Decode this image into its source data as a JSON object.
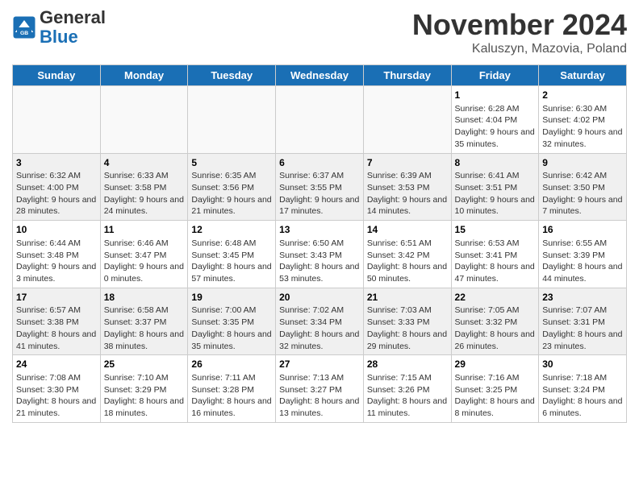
{
  "header": {
    "logo_line1": "General",
    "logo_line2": "Blue",
    "month_title": "November 2024",
    "location": "Kaluszyn, Mazovia, Poland"
  },
  "days_of_week": [
    "Sunday",
    "Monday",
    "Tuesday",
    "Wednesday",
    "Thursday",
    "Friday",
    "Saturday"
  ],
  "weeks": [
    [
      {
        "day": "",
        "info": "",
        "empty": true
      },
      {
        "day": "",
        "info": "",
        "empty": true
      },
      {
        "day": "",
        "info": "",
        "empty": true
      },
      {
        "day": "",
        "info": "",
        "empty": true
      },
      {
        "day": "",
        "info": "",
        "empty": true
      },
      {
        "day": "1",
        "info": "Sunrise: 6:28 AM\nSunset: 4:04 PM\nDaylight: 9 hours and 35 minutes."
      },
      {
        "day": "2",
        "info": "Sunrise: 6:30 AM\nSunset: 4:02 PM\nDaylight: 9 hours and 32 minutes."
      }
    ],
    [
      {
        "day": "3",
        "info": "Sunrise: 6:32 AM\nSunset: 4:00 PM\nDaylight: 9 hours and 28 minutes."
      },
      {
        "day": "4",
        "info": "Sunrise: 6:33 AM\nSunset: 3:58 PM\nDaylight: 9 hours and 24 minutes."
      },
      {
        "day": "5",
        "info": "Sunrise: 6:35 AM\nSunset: 3:56 PM\nDaylight: 9 hours and 21 minutes."
      },
      {
        "day": "6",
        "info": "Sunrise: 6:37 AM\nSunset: 3:55 PM\nDaylight: 9 hours and 17 minutes."
      },
      {
        "day": "7",
        "info": "Sunrise: 6:39 AM\nSunset: 3:53 PM\nDaylight: 9 hours and 14 minutes."
      },
      {
        "day": "8",
        "info": "Sunrise: 6:41 AM\nSunset: 3:51 PM\nDaylight: 9 hours and 10 minutes."
      },
      {
        "day": "9",
        "info": "Sunrise: 6:42 AM\nSunset: 3:50 PM\nDaylight: 9 hours and 7 minutes."
      }
    ],
    [
      {
        "day": "10",
        "info": "Sunrise: 6:44 AM\nSunset: 3:48 PM\nDaylight: 9 hours and 3 minutes."
      },
      {
        "day": "11",
        "info": "Sunrise: 6:46 AM\nSunset: 3:47 PM\nDaylight: 9 hours and 0 minutes."
      },
      {
        "day": "12",
        "info": "Sunrise: 6:48 AM\nSunset: 3:45 PM\nDaylight: 8 hours and 57 minutes."
      },
      {
        "day": "13",
        "info": "Sunrise: 6:50 AM\nSunset: 3:43 PM\nDaylight: 8 hours and 53 minutes."
      },
      {
        "day": "14",
        "info": "Sunrise: 6:51 AM\nSunset: 3:42 PM\nDaylight: 8 hours and 50 minutes."
      },
      {
        "day": "15",
        "info": "Sunrise: 6:53 AM\nSunset: 3:41 PM\nDaylight: 8 hours and 47 minutes."
      },
      {
        "day": "16",
        "info": "Sunrise: 6:55 AM\nSunset: 3:39 PM\nDaylight: 8 hours and 44 minutes."
      }
    ],
    [
      {
        "day": "17",
        "info": "Sunrise: 6:57 AM\nSunset: 3:38 PM\nDaylight: 8 hours and 41 minutes."
      },
      {
        "day": "18",
        "info": "Sunrise: 6:58 AM\nSunset: 3:37 PM\nDaylight: 8 hours and 38 minutes."
      },
      {
        "day": "19",
        "info": "Sunrise: 7:00 AM\nSunset: 3:35 PM\nDaylight: 8 hours and 35 minutes."
      },
      {
        "day": "20",
        "info": "Sunrise: 7:02 AM\nSunset: 3:34 PM\nDaylight: 8 hours and 32 minutes."
      },
      {
        "day": "21",
        "info": "Sunrise: 7:03 AM\nSunset: 3:33 PM\nDaylight: 8 hours and 29 minutes."
      },
      {
        "day": "22",
        "info": "Sunrise: 7:05 AM\nSunset: 3:32 PM\nDaylight: 8 hours and 26 minutes."
      },
      {
        "day": "23",
        "info": "Sunrise: 7:07 AM\nSunset: 3:31 PM\nDaylight: 8 hours and 23 minutes."
      }
    ],
    [
      {
        "day": "24",
        "info": "Sunrise: 7:08 AM\nSunset: 3:30 PM\nDaylight: 8 hours and 21 minutes."
      },
      {
        "day": "25",
        "info": "Sunrise: 7:10 AM\nSunset: 3:29 PM\nDaylight: 8 hours and 18 minutes."
      },
      {
        "day": "26",
        "info": "Sunrise: 7:11 AM\nSunset: 3:28 PM\nDaylight: 8 hours and 16 minutes."
      },
      {
        "day": "27",
        "info": "Sunrise: 7:13 AM\nSunset: 3:27 PM\nDaylight: 8 hours and 13 minutes."
      },
      {
        "day": "28",
        "info": "Sunrise: 7:15 AM\nSunset: 3:26 PM\nDaylight: 8 hours and 11 minutes."
      },
      {
        "day": "29",
        "info": "Sunrise: 7:16 AM\nSunset: 3:25 PM\nDaylight: 8 hours and 8 minutes."
      },
      {
        "day": "30",
        "info": "Sunrise: 7:18 AM\nSunset: 3:24 PM\nDaylight: 8 hours and 6 minutes."
      }
    ]
  ]
}
